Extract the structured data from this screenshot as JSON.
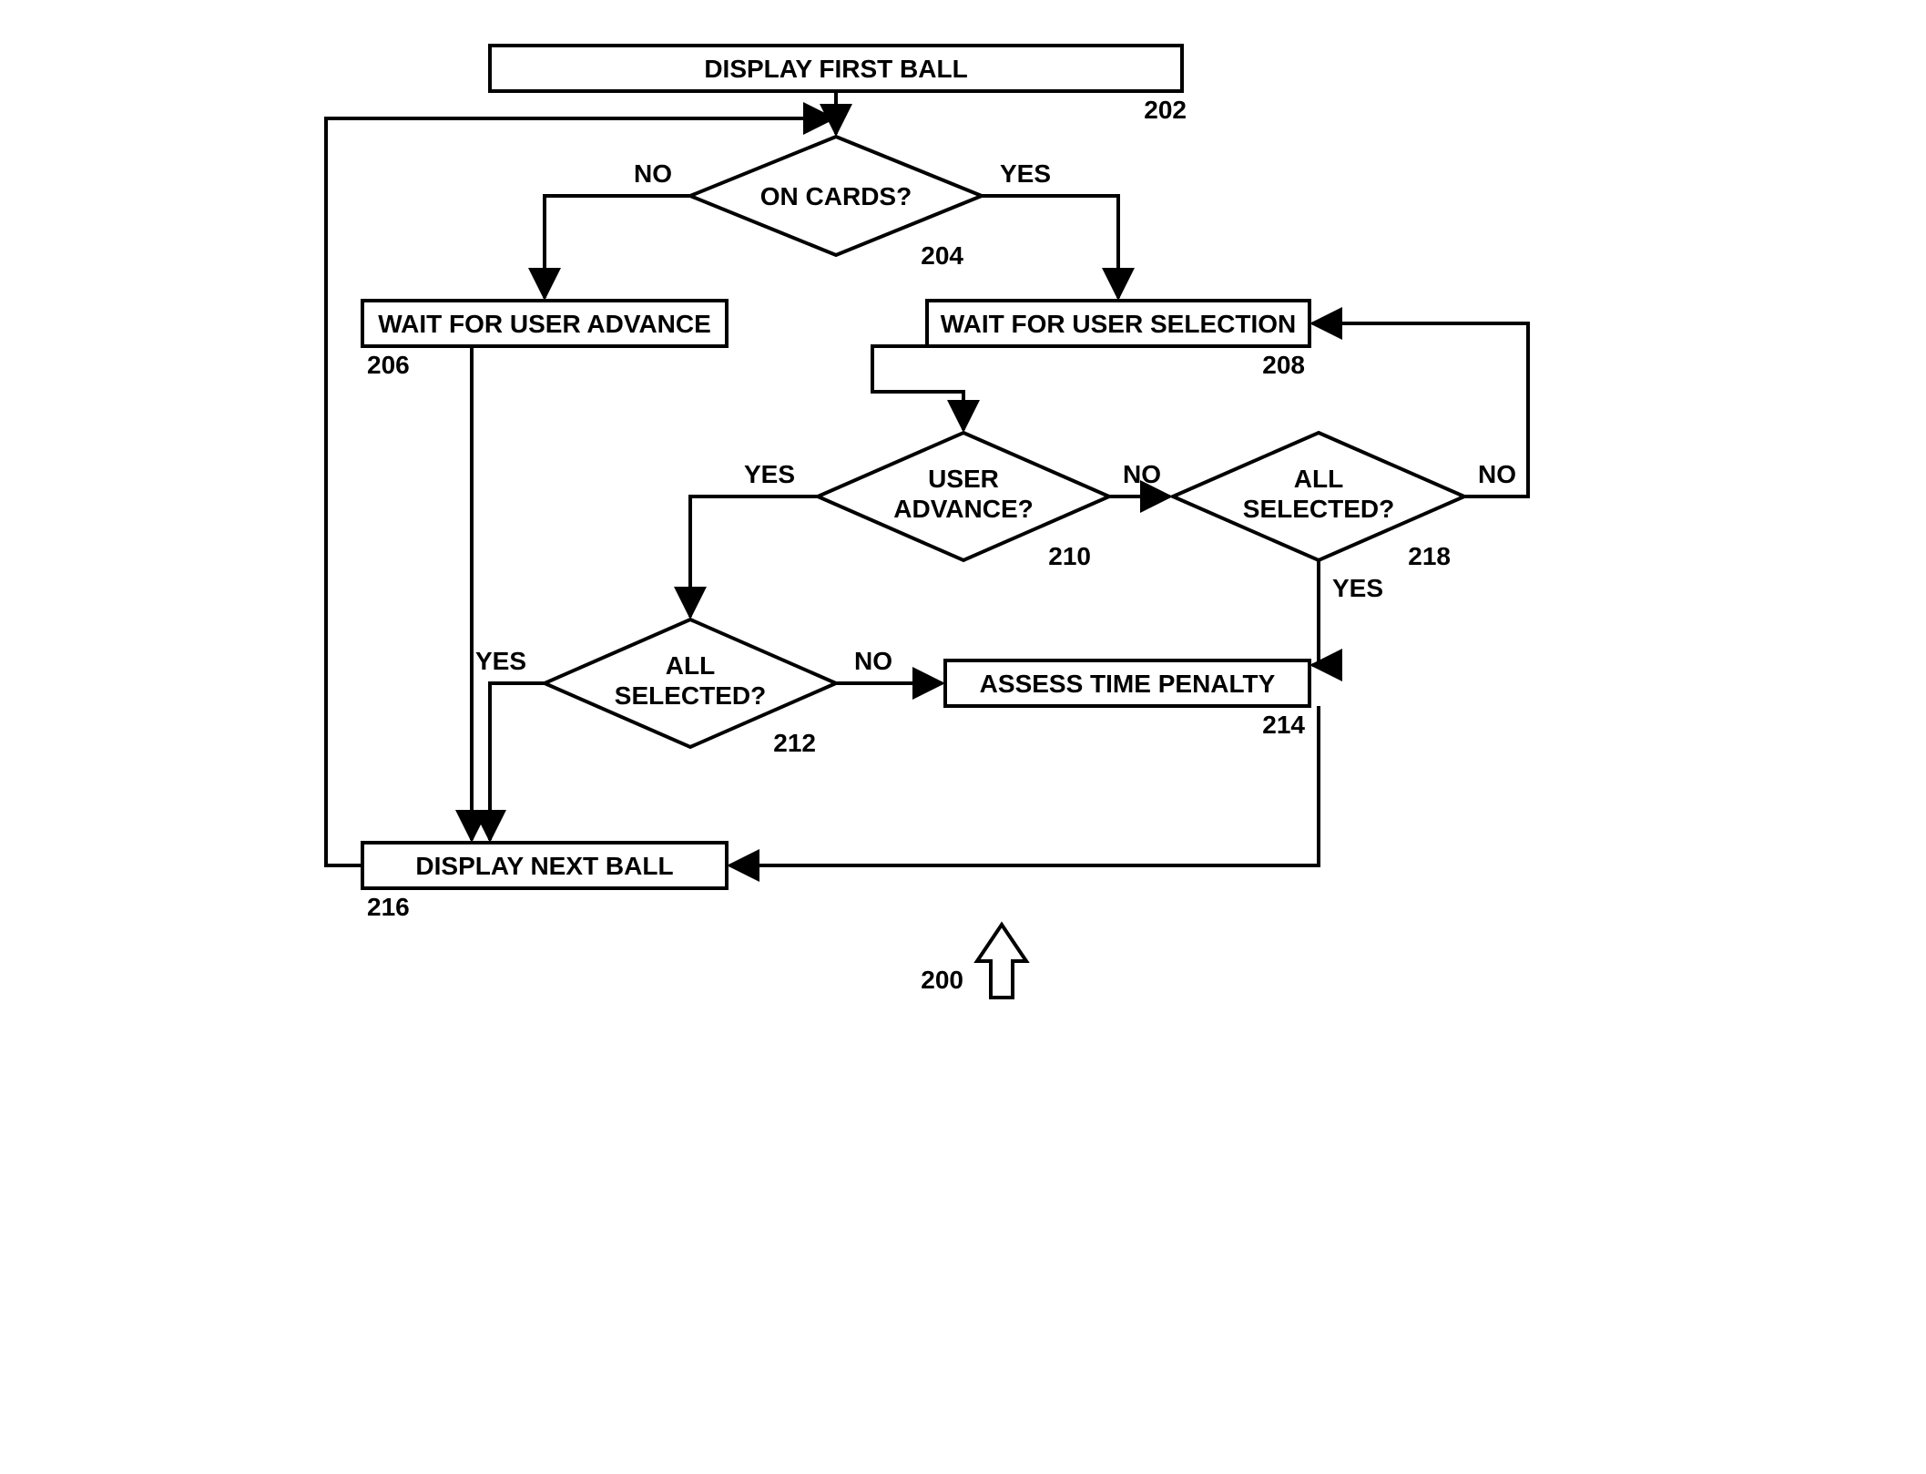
{
  "nodes": {
    "n202": {
      "label": "DISPLAY FIRST BALL",
      "ref": "202"
    },
    "n204": {
      "label": "ON CARDS?",
      "ref": "204"
    },
    "n206": {
      "label": "WAIT FOR USER ADVANCE",
      "ref": "206"
    },
    "n208": {
      "label": "WAIT FOR USER SELECTION",
      "ref": "208"
    },
    "n210": {
      "label_line1": "USER",
      "label_line2": "ADVANCE?",
      "ref": "210"
    },
    "n212": {
      "label_line1": "ALL",
      "label_line2": "SELECTED?",
      "ref": "212"
    },
    "n214": {
      "label": "ASSESS TIME PENALTY",
      "ref": "214"
    },
    "n216": {
      "label": "DISPLAY NEXT BALL",
      "ref": "216"
    },
    "n218": {
      "label_line1": "ALL",
      "label_line2": "SELECTED?",
      "ref": "218"
    }
  },
  "edges": {
    "yes": "YES",
    "no": "NO"
  },
  "figure_ref": "200"
}
